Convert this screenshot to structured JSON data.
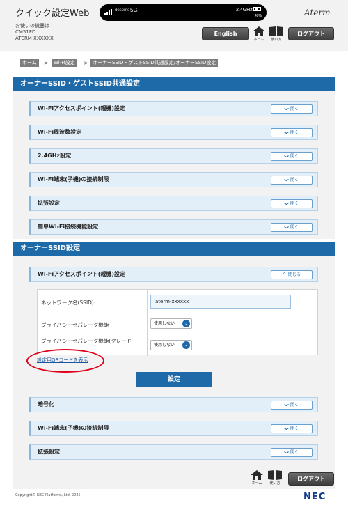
{
  "header": {
    "app_title": "クイック設定Web",
    "device_label": "お使いの機器は",
    "device_name": "CM51FD",
    "device_id": "ATERM-XXXXXX",
    "status": {
      "carrier": "docomo",
      "network": "5G",
      "band": "2.4GHz",
      "battery": "49%"
    },
    "logo": "Aterm",
    "english_label": "English",
    "home_label": "ホーム",
    "help_label": "使い方",
    "logout_label": "ログアウト"
  },
  "breadcrumb": [
    "ホーム",
    "Wi-Fi設定",
    "オーナーSSID・ゲストSSID共通設定/オーナーSSID設定"
  ],
  "breadcrumb_sep": ">",
  "common_section": {
    "title": "オーナーSSID・ゲストSSID共通設定",
    "items": [
      {
        "label": "Wi-Fiアクセスポイント(親機)設定",
        "button": "開く"
      },
      {
        "label": "Wi-Fi周波数設定",
        "button": "開く"
      },
      {
        "label": "2.4GHz設定",
        "button": "開く"
      },
      {
        "label": "Wi-Fi端末(子機)の接続制限",
        "button": "開く"
      },
      {
        "label": "拡張設定",
        "button": "開く"
      },
      {
        "label": "簡単Wi-Fi接続機能設定",
        "button": "開く"
      }
    ]
  },
  "owner_section": {
    "title": "オーナーSSID設定",
    "expanded": {
      "label": "Wi-Fiアクセスポイント(親機)設定",
      "button": "閉じる"
    },
    "form": {
      "ssid_label": "ネットワーク名(SSID)",
      "ssid_value": "aterm-xxxxxx",
      "privacy_label": "プライバシーセパレータ機能",
      "privacy_value": "使用しない",
      "privacy2_label": "プライバシーセパレータ機能(クレード",
      "privacy2_value": "使用しない"
    },
    "qr_link": "設定用QRコードを表示",
    "submit": "設定",
    "items": [
      {
        "label": "暗号化",
        "button": "開く"
      },
      {
        "label": "Wi-Fi端末(子機)の接続制限",
        "button": "開く"
      },
      {
        "label": "拡張設定",
        "button": "開く"
      }
    ]
  },
  "footer": {
    "home_label": "ホーム",
    "help_label": "使い方",
    "logout_label": "ログアウト",
    "copyright": "Copyright© NEC Platforms, Ltd. 2025",
    "nec_logo": "NEC"
  },
  "colors": {
    "primary": "#1e6aa9",
    "highlight_ring": "#e0001a",
    "panel": "#e3eff8"
  }
}
